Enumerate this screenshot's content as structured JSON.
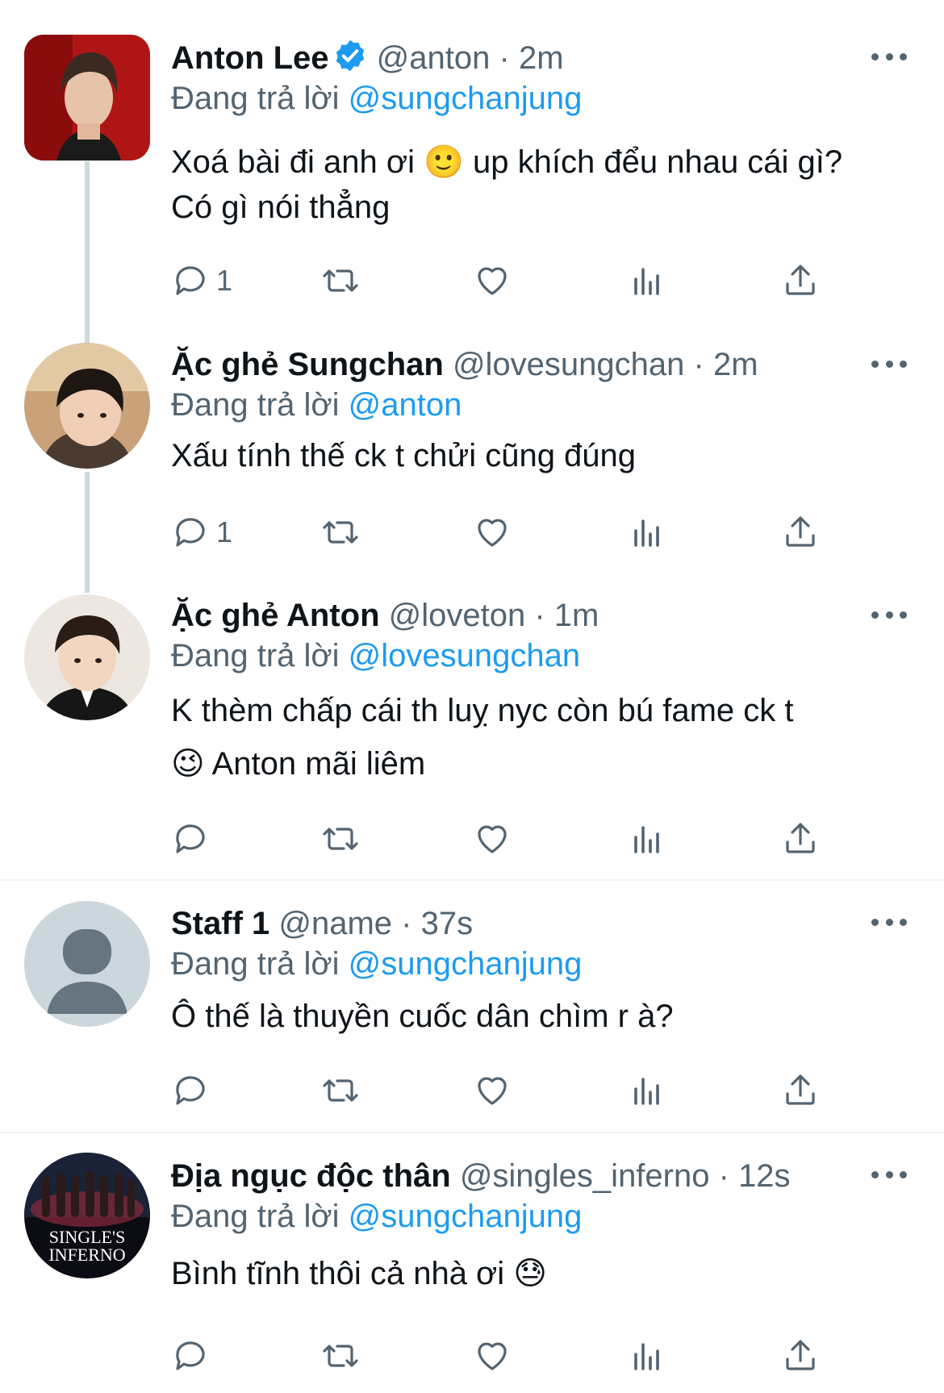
{
  "reply_prefix": "Đang trả lời",
  "tweets": [
    {
      "name": "Anton Lee",
      "verified": true,
      "handle": "@anton",
      "sep": "·",
      "time": "2m",
      "reply_to": "@sungchanjung",
      "text_lines": [
        "Xoá bài đi anh ơi 🙂  up khích đểu nhau cái gì?",
        "Có gì nói thẳng"
      ],
      "reply_count": "1",
      "avatar": "photo-red-background"
    },
    {
      "name": "Ặc ghẻ Sungchan",
      "verified": false,
      "handle": "@lovesungchan",
      "sep": "·",
      "time": "2m",
      "reply_to": "@anton",
      "text_lines": [
        "Xấu tính thế ck t chửi cũng đúng"
      ],
      "reply_count": "1",
      "avatar": "photo-child"
    },
    {
      "name": "Ặc ghẻ Anton",
      "verified": false,
      "handle": "@loveton",
      "sep": "·",
      "time": "1m",
      "reply_to": "@lovesungchan",
      "text_lines": [
        "K thèm chấp cái th luỵ nyc còn bú fame ck t",
        "😉  Anton mãi liêm"
      ],
      "reply_count": "",
      "avatar": "photo-child-suit"
    },
    {
      "name": "Staff 1",
      "verified": false,
      "handle": "@name",
      "sep": "·",
      "time": "37s",
      "reply_to": "@sungchanjung",
      "text_lines": [
        "Ô thế là thuyền cuốc dân chìm r à?"
      ],
      "reply_count": "",
      "avatar": "default-avatar"
    },
    {
      "name": "Địa ngục độc thân",
      "verified": false,
      "handle": "@singles_inferno",
      "sep": "·",
      "time": "12s",
      "reply_to": "@sungchanjung",
      "text_lines": [
        "Bình tĩnh thôi cả nhà ơi 😓"
      ],
      "reply_count": "",
      "avatar": "singles-inferno-logo",
      "logo_text": [
        "SINGLE'S",
        "INFERNO"
      ]
    }
  ],
  "icons": [
    "reply-icon",
    "retweet-icon",
    "like-icon",
    "views-icon",
    "share-icon",
    "more-icon",
    "verified-icon"
  ],
  "colors": {
    "accent": "#1d9bf0",
    "secondary": "#536471",
    "text": "#0f1419",
    "thread_line": "#cfd9de"
  }
}
